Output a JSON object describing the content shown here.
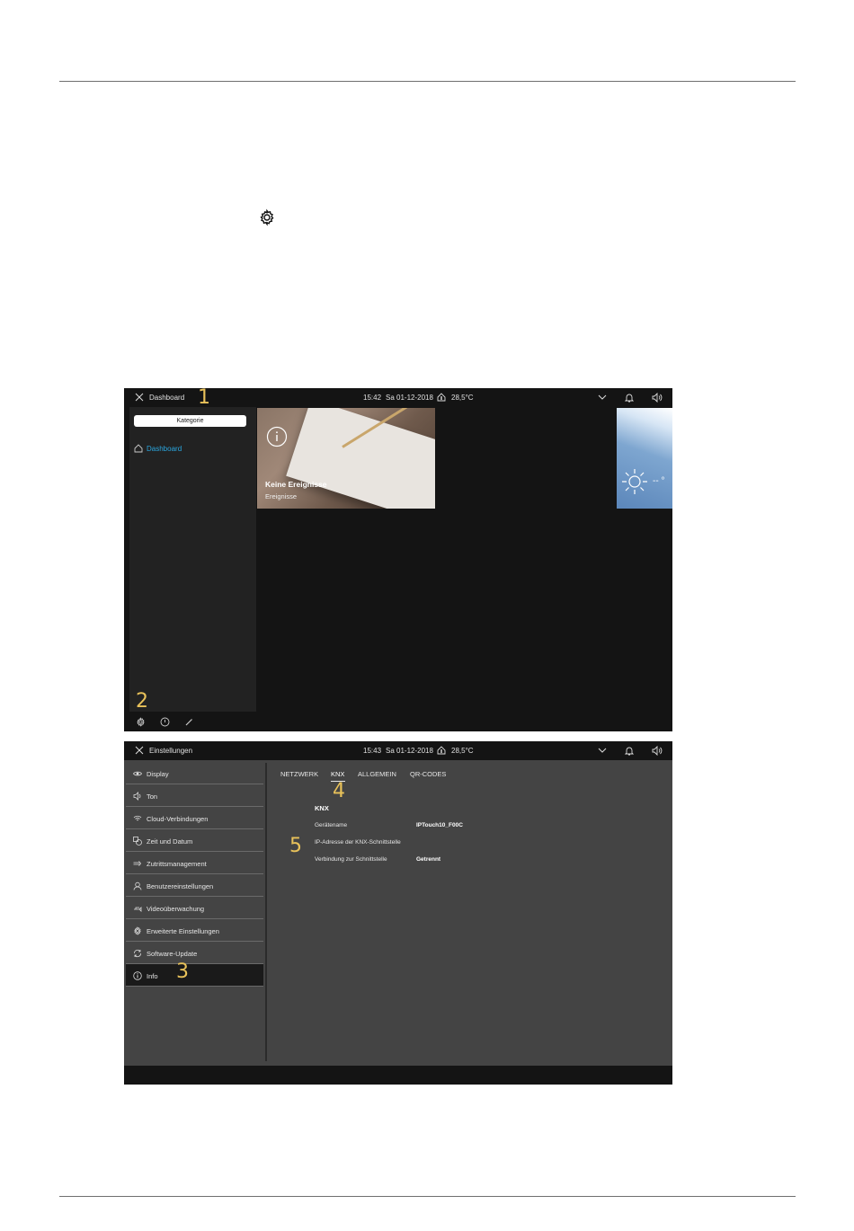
{
  "shot1": {
    "topbar": {
      "title": "Dashboard",
      "time": "15:42",
      "date": "Sa 01-12-2018",
      "temperature": "28,5°C"
    },
    "sidebar": {
      "category_button": "Kategorie",
      "nav_item": "Dashboard"
    },
    "tile": {
      "title": "Keine Ereignisse",
      "subtitle": "Ereignisse"
    },
    "weather": {
      "value_text": "-- °"
    },
    "accent_color": "#2aa7e0"
  },
  "shot2": {
    "topbar": {
      "title": "Einstellungen",
      "time": "15:43",
      "date": "Sa 01-12-2018",
      "temperature": "28,5°C"
    },
    "menu": [
      {
        "label": "Display",
        "icon": "eye-icon"
      },
      {
        "label": "Ton",
        "icon": "speaker-icon"
      },
      {
        "label": "Cloud-Verbindungen",
        "icon": "cloud-icon"
      },
      {
        "label": "Zeit und Datum",
        "icon": "clock-icon"
      },
      {
        "label": "Zutrittsmanagement",
        "icon": "key-icon"
      },
      {
        "label": "Benutzereinstellungen",
        "icon": "user-icon"
      },
      {
        "label": "Videoüberwachung",
        "icon": "camera-icon"
      },
      {
        "label": "Erweiterte Einstellungen",
        "icon": "gear-icon"
      },
      {
        "label": "Software-Update",
        "icon": "refresh-icon"
      },
      {
        "label": "Info",
        "icon": "info-icon",
        "active": true
      }
    ],
    "tabs": [
      "NETZWERK",
      "KNX",
      "ALLGEMEIN",
      "QR-CODES"
    ],
    "selected_tab": "KNX",
    "section_title": "KNX",
    "fields": [
      {
        "label": "Gerätename",
        "value": "IPTouch10_F00C"
      },
      {
        "label": "IP-Adresse der KNX-Schnittstelle",
        "value": ""
      },
      {
        "label": "Verbindung zur Schnittstelle",
        "value": "Getrennt"
      }
    ]
  },
  "callouts": [
    "1",
    "2",
    "3",
    "4",
    "5"
  ],
  "callout_color": "#e9c25a"
}
